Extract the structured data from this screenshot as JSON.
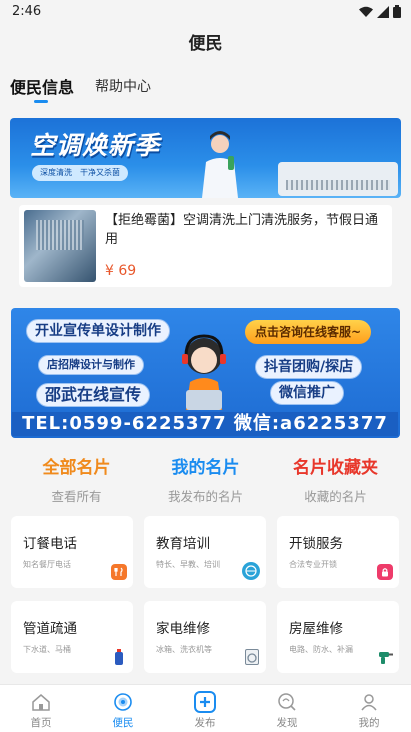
{
  "status": {
    "time": "2:46"
  },
  "header": {
    "title": "便民"
  },
  "tabs": [
    {
      "label": "便民信息"
    },
    {
      "label": "帮助中心"
    }
  ],
  "banner1": {
    "headline": "空调焕新季",
    "tags": "深度清洗　干净又杀菌"
  },
  "listing": {
    "description": "【拒绝霉菌】空调清洗上门清洗服务，节假日通用",
    "price": "¥ 69"
  },
  "banner2": {
    "pills": [
      "开业宣传单设计制作",
      "店招牌设计与制作",
      "邵武在线宣传",
      "抖音团购/探店",
      "微信推广"
    ],
    "cta": "点击咨询在线客服~",
    "footer": "TEL:0599-6225377 微信:a6225377"
  },
  "quick_links": [
    {
      "title": "全部名片",
      "subtitle": "查看所有",
      "color": "#f08a1c"
    },
    {
      "title": "我的名片",
      "subtitle": "我发布的名片",
      "color": "#1a8cf0"
    },
    {
      "title": "名片收藏夹",
      "subtitle": "收藏的名片",
      "color": "#e8372b"
    }
  ],
  "services": [
    {
      "title": "订餐电话",
      "subtitle": "知名餐厅电话",
      "icon": "utensils-icon",
      "color": "#f5772a"
    },
    {
      "title": "教育培训",
      "subtitle": "特长、早教、培训",
      "icon": "globe-icon",
      "color": "#2aa3d8"
    },
    {
      "title": "开锁服务",
      "subtitle": "合法专业开锁",
      "icon": "lock-icon",
      "color": "#ee3b6a"
    },
    {
      "title": "管道疏通",
      "subtitle": "下水道、马桶",
      "icon": "bottle-icon",
      "color": "#2b5bbf"
    },
    {
      "title": "家电维修",
      "subtitle": "冰箱、洗衣机等",
      "icon": "washer-icon",
      "color": "#7a8a99"
    },
    {
      "title": "房屋维修",
      "subtitle": "电路、防水、补漏",
      "icon": "drill-icon",
      "color": "#1e8c6a"
    }
  ],
  "bottom_nav": [
    {
      "label": "首页",
      "icon": "home-icon"
    },
    {
      "label": "便民",
      "icon": "convenience-icon"
    },
    {
      "label": "发布",
      "icon": "plus-icon"
    },
    {
      "label": "发现",
      "icon": "discover-icon"
    },
    {
      "label": "我的",
      "icon": "user-icon"
    }
  ]
}
